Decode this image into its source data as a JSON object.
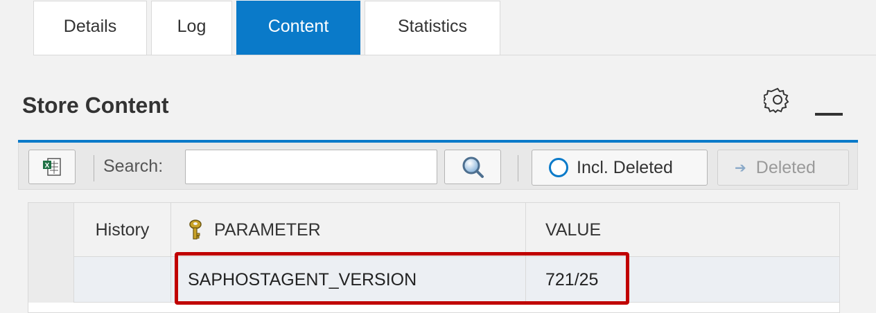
{
  "tabs": [
    {
      "label": "Details",
      "active": false
    },
    {
      "label": "Log",
      "active": false
    },
    {
      "label": "Content",
      "active": true
    },
    {
      "label": "Statistics",
      "active": false
    }
  ],
  "panel": {
    "title": "Store Content",
    "icons": [
      "gear-icon",
      "minimize-icon"
    ]
  },
  "toolbar": {
    "export_icon": "excel-export-icon",
    "search_label": "Search:",
    "search_value": "",
    "search_icon": "magnifier-icon",
    "incl_deleted_label": "Incl. Deleted",
    "deleted_label": "Deleted"
  },
  "table": {
    "columns": [
      "History",
      "PARAMETER",
      "VALUE"
    ],
    "key_icon": "key-icon",
    "rows": [
      {
        "history": "",
        "parameter": "SAPHOSTAGENT_VERSION",
        "value": "721/25"
      }
    ]
  },
  "colors": {
    "accent": "#0a7ac9",
    "highlight_border": "#c00000"
  }
}
